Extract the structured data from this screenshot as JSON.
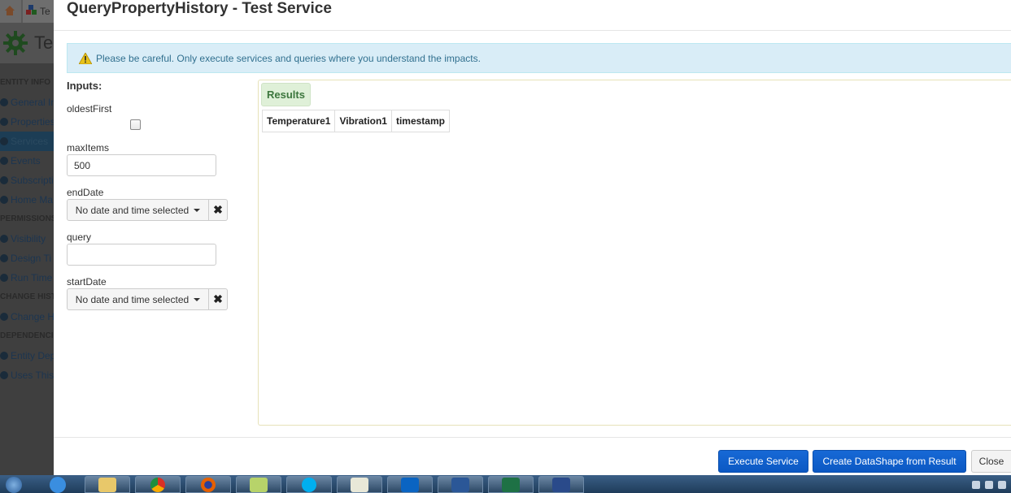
{
  "background_app": {
    "tabs": [
      "",
      "Te"
    ],
    "header_title": "Te",
    "nav": [
      {
        "type": "section",
        "label": "ENTITY INFO"
      },
      {
        "type": "item",
        "label": "General Inf"
      },
      {
        "type": "item",
        "label": "Properties"
      },
      {
        "type": "item",
        "label": "Services",
        "active": true
      },
      {
        "type": "item",
        "label": "Events"
      },
      {
        "type": "item",
        "label": "Subscripti"
      },
      {
        "type": "item",
        "label": "Home Ma"
      },
      {
        "type": "section",
        "label": "PERMISSIONS"
      },
      {
        "type": "item",
        "label": "Visibility"
      },
      {
        "type": "item",
        "label": "Design Ti"
      },
      {
        "type": "item",
        "label": "Run Time"
      },
      {
        "type": "section",
        "label": "CHANGE HIST"
      },
      {
        "type": "item",
        "label": "Change H"
      },
      {
        "type": "section",
        "label": "DEPENDENCIE"
      },
      {
        "type": "item",
        "label": "Entity Dep"
      },
      {
        "type": "item",
        "label": "Uses This"
      }
    ]
  },
  "modal": {
    "title": "QueryPropertyHistory - Test Service",
    "alert_text": "Please be careful. Only execute services and queries where you understand the impacts.",
    "inputs_title": "Inputs:",
    "fields": {
      "oldestFirst": {
        "label": "oldestFirst",
        "checked": false
      },
      "maxItems": {
        "label": "maxItems",
        "value": "500"
      },
      "endDate": {
        "label": "endDate",
        "button_text": "No date and time selected"
      },
      "query": {
        "label": "query",
        "value": ""
      },
      "startDate": {
        "label": "startDate",
        "button_text": "No date and time selected"
      }
    },
    "results": {
      "tab_label": "Results",
      "columns": [
        "Temperature1",
        "Vibration1",
        "timestamp"
      ]
    },
    "footer": {
      "execute_label": "Execute Service",
      "create_datashape_label": "Create DataShape from Result",
      "close_label": "Close"
    }
  },
  "colors": {
    "primary_button": "#0b58c3",
    "alert_bg": "#d9edf7",
    "alert_text": "#31708f",
    "results_tab_bg": "#dff0d8",
    "results_tab_text": "#3c763d"
  },
  "taskbar": {
    "icons": [
      "start-orb",
      "internet-explorer",
      "file-explorer",
      "chrome",
      "firefox",
      "windows-explorer",
      "skype",
      "notepad",
      "outlook",
      "word",
      "excel",
      "app"
    ]
  }
}
